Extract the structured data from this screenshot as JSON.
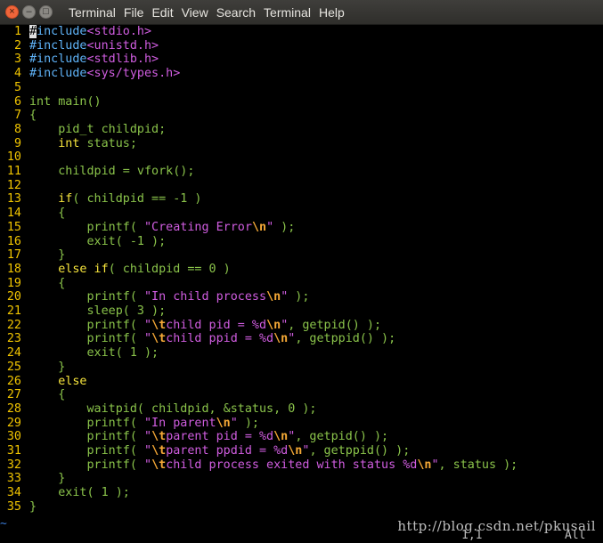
{
  "window": {
    "menu": [
      "Terminal",
      "File",
      "Edit",
      "View",
      "Search",
      "Terminal",
      "Help"
    ],
    "buttons": {
      "close": "×",
      "minimize": "–",
      "maximize": "□"
    }
  },
  "editor": {
    "lines": [
      {
        "n": "1",
        "tokens": [
          [
            "cursor",
            "#"
          ],
          [
            "pp",
            "include"
          ],
          [
            "inc",
            "<stdio.h>"
          ]
        ]
      },
      {
        "n": "2",
        "tokens": [
          [
            "pp",
            "#include"
          ],
          [
            "inc",
            "<unistd.h>"
          ]
        ]
      },
      {
        "n": "3",
        "tokens": [
          [
            "pp",
            "#include"
          ],
          [
            "inc",
            "<stdlib.h>"
          ]
        ]
      },
      {
        "n": "4",
        "tokens": [
          [
            "pp",
            "#include"
          ],
          [
            "inc",
            "<sys/types.h>"
          ]
        ]
      },
      {
        "n": "5",
        "tokens": []
      },
      {
        "n": "6",
        "tokens": [
          [
            "ty",
            "int"
          ],
          [
            "ty",
            " main()"
          ]
        ]
      },
      {
        "n": "7",
        "tokens": [
          [
            "ty",
            "{"
          ]
        ]
      },
      {
        "n": "8",
        "tokens": [
          [
            "ty",
            "    pid_t childpid;"
          ]
        ]
      },
      {
        "n": "9",
        "tokens": [
          [
            "plain",
            "    "
          ],
          [
            "kw",
            "int"
          ],
          [
            "ty",
            " status;"
          ]
        ]
      },
      {
        "n": "10",
        "tokens": []
      },
      {
        "n": "11",
        "tokens": [
          [
            "ty",
            "    childpid = vfork();"
          ]
        ]
      },
      {
        "n": "12",
        "tokens": []
      },
      {
        "n": "13",
        "tokens": [
          [
            "plain",
            "    "
          ],
          [
            "kw",
            "if"
          ],
          [
            "ty",
            "( childpid == -1 )"
          ]
        ]
      },
      {
        "n": "14",
        "tokens": [
          [
            "ty",
            "    {"
          ]
        ]
      },
      {
        "n": "15",
        "tokens": [
          [
            "ty",
            "        printf( "
          ],
          [
            "str",
            "\"Creating Error"
          ],
          [
            "esc",
            "\\n"
          ],
          [
            "str",
            "\""
          ],
          [
            "ty",
            " );"
          ]
        ]
      },
      {
        "n": "16",
        "tokens": [
          [
            "ty",
            "        exit( -1 );"
          ]
        ]
      },
      {
        "n": "17",
        "tokens": [
          [
            "ty",
            "    }"
          ]
        ]
      },
      {
        "n": "18",
        "tokens": [
          [
            "plain",
            "    "
          ],
          [
            "kw",
            "else if"
          ],
          [
            "ty",
            "( childpid == 0 )"
          ]
        ]
      },
      {
        "n": "19",
        "tokens": [
          [
            "ty",
            "    {"
          ]
        ]
      },
      {
        "n": "20",
        "tokens": [
          [
            "ty",
            "        printf( "
          ],
          [
            "str",
            "\"In child process"
          ],
          [
            "esc",
            "\\n"
          ],
          [
            "str",
            "\""
          ],
          [
            "ty",
            " );"
          ]
        ]
      },
      {
        "n": "21",
        "tokens": [
          [
            "ty",
            "        sleep( 3 );"
          ]
        ]
      },
      {
        "n": "22",
        "tokens": [
          [
            "ty",
            "        printf( "
          ],
          [
            "str",
            "\""
          ],
          [
            "esc",
            "\\t"
          ],
          [
            "str",
            "child pid = %d"
          ],
          [
            "esc",
            "\\n"
          ],
          [
            "str",
            "\""
          ],
          [
            "ty",
            ", getpid() );"
          ]
        ]
      },
      {
        "n": "23",
        "tokens": [
          [
            "ty",
            "        printf( "
          ],
          [
            "str",
            "\""
          ],
          [
            "esc",
            "\\t"
          ],
          [
            "str",
            "child ppid = %d"
          ],
          [
            "esc",
            "\\n"
          ],
          [
            "str",
            "\""
          ],
          [
            "ty",
            ", getppid() );"
          ]
        ]
      },
      {
        "n": "24",
        "tokens": [
          [
            "ty",
            "        exit( 1 );"
          ]
        ]
      },
      {
        "n": "25",
        "tokens": [
          [
            "ty",
            "    }"
          ]
        ]
      },
      {
        "n": "26",
        "tokens": [
          [
            "plain",
            "    "
          ],
          [
            "kw",
            "else"
          ]
        ]
      },
      {
        "n": "27",
        "tokens": [
          [
            "ty",
            "    {"
          ]
        ]
      },
      {
        "n": "28",
        "tokens": [
          [
            "ty",
            "        waitpid( childpid, &status, 0 );"
          ]
        ]
      },
      {
        "n": "29",
        "tokens": [
          [
            "ty",
            "        printf( "
          ],
          [
            "str",
            "\"In parent"
          ],
          [
            "esc",
            "\\n"
          ],
          [
            "str",
            "\""
          ],
          [
            "ty",
            " );"
          ]
        ]
      },
      {
        "n": "30",
        "tokens": [
          [
            "ty",
            "        printf( "
          ],
          [
            "str",
            "\""
          ],
          [
            "esc",
            "\\t"
          ],
          [
            "str",
            "parent pid = %d"
          ],
          [
            "esc",
            "\\n"
          ],
          [
            "str",
            "\""
          ],
          [
            "ty",
            ", getpid() );"
          ]
        ]
      },
      {
        "n": "31",
        "tokens": [
          [
            "ty",
            "        printf( "
          ],
          [
            "str",
            "\""
          ],
          [
            "esc",
            "\\t"
          ],
          [
            "str",
            "parent ppdid = %d"
          ],
          [
            "esc",
            "\\n"
          ],
          [
            "str",
            "\""
          ],
          [
            "ty",
            ", getppid() );"
          ]
        ]
      },
      {
        "n": "32",
        "tokens": [
          [
            "ty",
            "        printf( "
          ],
          [
            "str",
            "\""
          ],
          [
            "esc",
            "\\t"
          ],
          [
            "str",
            "child process exited with status %d"
          ],
          [
            "esc",
            "\\n"
          ],
          [
            "str",
            "\""
          ],
          [
            "ty",
            ", status );"
          ]
        ]
      },
      {
        "n": "33",
        "tokens": [
          [
            "ty",
            "    }"
          ]
        ]
      },
      {
        "n": "34",
        "tokens": [
          [
            "ty",
            "    exit( 1 );"
          ]
        ]
      },
      {
        "n": "35",
        "tokens": [
          [
            "ty",
            "}"
          ]
        ]
      }
    ],
    "tilde": "~",
    "cursor_position": "1,1",
    "scroll_position": "All"
  },
  "watermark": "http://blog.csdn.net/pkusail",
  "colors": {
    "line_number": "#f0c400",
    "preprocessor": "#5fb3f8",
    "string": "#d05de0",
    "type": "#8ac34a",
    "keyword": "#f7e53d",
    "escape": "#f4a836"
  }
}
